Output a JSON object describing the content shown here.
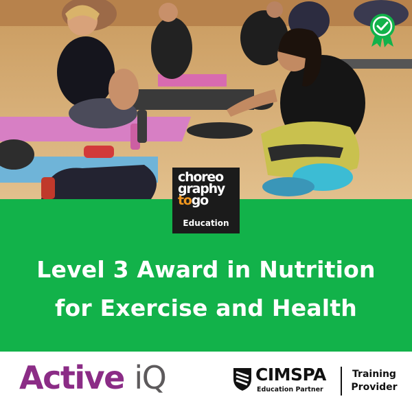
{
  "logo": {
    "line1": "choreo",
    "line2": "graphy",
    "line3_a": "to",
    "line3_b": "go",
    "line4": "Education"
  },
  "headline": {
    "line1": "Level 3 Award in Nutrition",
    "line2": "for Exercise and Health"
  },
  "partners": {
    "activeiq_main": "Active ",
    "activeiq_iq": "iQ",
    "cimspa_name": "CIMSPA",
    "cimspa_sub": "Education Partner",
    "training_line1": "Training",
    "training_line2": "Provider"
  },
  "colors": {
    "band_green": "#12b24a",
    "activeiq_purple": "#8b2c86",
    "logo_orange": "#f0961e"
  },
  "icons": {
    "badge": "award-ribbon-checkmark-icon",
    "cimspa": "cimspa-shield-icon"
  }
}
